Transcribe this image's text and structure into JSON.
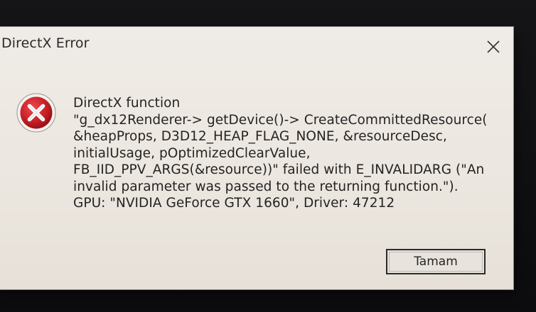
{
  "window": {
    "title": "DirectX Error"
  },
  "icons": {
    "close": "close-icon",
    "error": "error-icon"
  },
  "message": {
    "lines": [
      "DirectX function",
      "\"g_dx12Renderer-> getDevice()-> CreateCommittedResource(",
      "&heapProps, D3D12_HEAP_FLAG_NONE, &resourceDesc,",
      "initialUsage, pOptimizedClearValue,",
      "FB_IID_PPV_ARGS(&resource))\" failed with E_INVALIDARG (\"An",
      "invalid parameter was passed to the returning function.\").",
      "GPU: \"NVIDIA GeForce GTX 1660\", Driver: 47212"
    ]
  },
  "buttons": {
    "ok_label": "Tamam"
  },
  "colors": {
    "dialog_background": "#ece7e0",
    "error_red": "#c8232b",
    "text": "#242424"
  }
}
